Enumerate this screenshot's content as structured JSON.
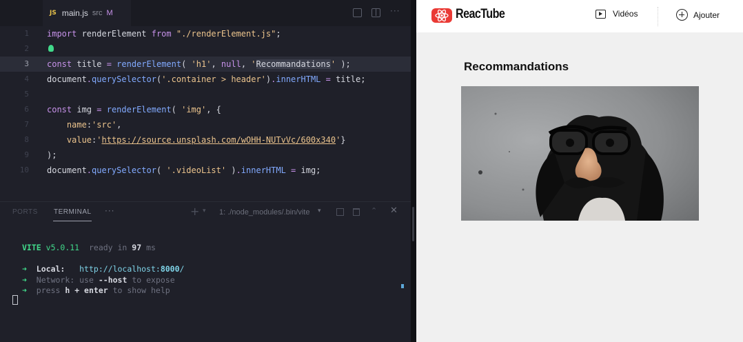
{
  "editor": {
    "tab": {
      "lang_badge": "JS",
      "filename": "main.js",
      "folder": "src",
      "status": "M"
    },
    "lines": [
      {
        "n": "1",
        "tokens": [
          [
            "kw",
            "import "
          ],
          [
            "var",
            "renderElement "
          ],
          [
            "kw",
            "from "
          ],
          [
            "str",
            "\"./renderElement.js\""
          ],
          [
            "var",
            ";"
          ]
        ]
      },
      {
        "n": "2",
        "tokens": []
      },
      {
        "n": "3",
        "tokens": [
          [
            "kw",
            "const "
          ],
          [
            "var",
            "title "
          ],
          [
            "op",
            "= "
          ],
          [
            "fn",
            "renderElement"
          ],
          [
            "var",
            "( "
          ],
          [
            "str",
            "'h1'"
          ],
          [
            "var",
            ", "
          ],
          [
            "nul",
            "null"
          ],
          [
            "var",
            ", "
          ],
          [
            "str",
            "'"
          ],
          [
            "hl",
            "Recommandations"
          ],
          [
            "str",
            "'"
          ],
          [
            "var",
            " );"
          ]
        ]
      },
      {
        "n": "4",
        "tokens": [
          [
            "var",
            "document"
          ],
          [
            "op",
            "."
          ],
          [
            "fn",
            "querySelector"
          ],
          [
            "var",
            "("
          ],
          [
            "str",
            "'.container > header'"
          ],
          [
            "var",
            ")"
          ],
          [
            "op",
            "."
          ],
          [
            "fn",
            "innerHTML "
          ],
          [
            "op",
            "= "
          ],
          [
            "var",
            "title;"
          ]
        ]
      },
      {
        "n": "5",
        "tokens": []
      },
      {
        "n": "6",
        "tokens": [
          [
            "kw",
            "const "
          ],
          [
            "var",
            "img "
          ],
          [
            "op",
            "= "
          ],
          [
            "fn",
            "renderElement"
          ],
          [
            "var",
            "( "
          ],
          [
            "str",
            "'img'"
          ],
          [
            "var",
            ", {"
          ]
        ]
      },
      {
        "n": "7",
        "tokens": [
          [
            "var",
            "    "
          ],
          [
            "prop",
            "name"
          ],
          [
            "var",
            ":"
          ],
          [
            "str",
            "'src'"
          ],
          [
            "var",
            ","
          ]
        ]
      },
      {
        "n": "8",
        "tokens": [
          [
            "var",
            "    "
          ],
          [
            "prop",
            "value"
          ],
          [
            "var",
            ":"
          ],
          [
            "str",
            "'"
          ],
          [
            "str-u",
            "https://source.unsplash.com/wOHH-NUTvVc/600x340"
          ],
          [
            "str",
            "'"
          ],
          [
            "var",
            "}"
          ]
        ]
      },
      {
        "n": "9",
        "tokens": [
          [
            "var",
            ");"
          ]
        ]
      },
      {
        "n": "10",
        "tokens": [
          [
            "var",
            "document"
          ],
          [
            "op",
            "."
          ],
          [
            "fn",
            "querySelector"
          ],
          [
            "var",
            "( "
          ],
          [
            "str",
            "'.videoList'"
          ],
          [
            "var",
            " )"
          ],
          [
            "op",
            "."
          ],
          [
            "fn",
            "innerHTML "
          ],
          [
            "op",
            "= "
          ],
          [
            "var",
            "img;"
          ]
        ]
      }
    ]
  },
  "panel": {
    "tabs": {
      "ports": "PORTS",
      "terminal": "TERMINAL",
      "more": "···"
    },
    "terminal_select": "1: ./node_modules/.bin/vite",
    "output": {
      "vite_name": "VITE",
      "vite_version": "v5.0.11",
      "ready_prefix": "ready in",
      "ready_ms": "97",
      "ready_unit": "ms",
      "arrow": "➜",
      "local_label": "Local:",
      "local_url_prefix": "http://localhost:",
      "local_port": "8000",
      "local_url_suffix": "/",
      "network_label": "Network:",
      "network_use": "use",
      "network_flag": "--host",
      "network_rest": "to expose",
      "press": "press",
      "key_h": "h + enter",
      "help_rest": "to show help"
    }
  },
  "browser": {
    "brand": "ReacTube",
    "nav": {
      "videos": "Vidéos",
      "add": "Ajouter"
    },
    "page_title": "Recommandations",
    "colors": {
      "brand_red": "#ea3a35"
    }
  }
}
